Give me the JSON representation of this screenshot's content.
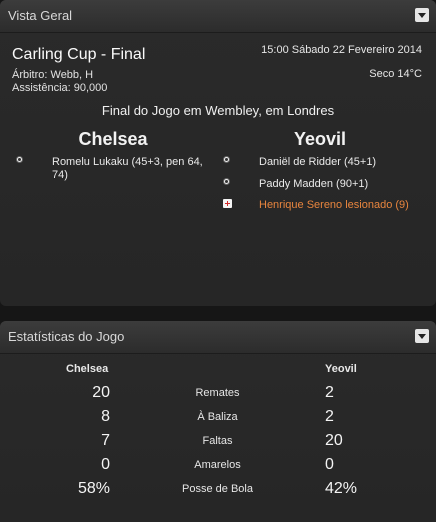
{
  "overview": {
    "title": "Vista Geral",
    "competition": "Carling Cup - Final",
    "referee": "Árbitro: Webb, H",
    "attendance": "Assistência: 90,000",
    "datetime": "15:00 Sábado 22 Fevereiro 2014",
    "weather": "Seco 14°C",
    "result_text": "Final do Jogo em Wembley, em Londres",
    "home": {
      "name": "Chelsea",
      "events": [
        {
          "icon": "goal-ball-icon",
          "text": "Romelu Lukaku (45+3, pen 64, 74)"
        }
      ]
    },
    "away": {
      "name": "Yeovil",
      "events": [
        {
          "icon": "goal-ball-icon",
          "text": "Daniël de Ridder (45+1)"
        },
        {
          "icon": "goal-ball-icon",
          "text": "Paddy Madden (90+1)"
        },
        {
          "icon": "injury-icon",
          "text": "Henrique Sereno lesionado (9)"
        }
      ]
    }
  },
  "stats": {
    "title": "Estatísticas do Jogo",
    "home_team": "Chelsea",
    "away_team": "Yeovil",
    "rows": [
      {
        "label": "Remates",
        "home": "20",
        "away": "2"
      },
      {
        "label": "À Baliza",
        "home": "8",
        "away": "2"
      },
      {
        "label": "Faltas",
        "home": "7",
        "away": "20"
      },
      {
        "label": "Amarelos",
        "home": "0",
        "away": "0"
      },
      {
        "label": "Posse de Bola",
        "home": "58%",
        "away": "42%"
      }
    ]
  },
  "colors": {
    "background": "#161616",
    "panel": "#272727",
    "injury_text": "#e8853e"
  }
}
